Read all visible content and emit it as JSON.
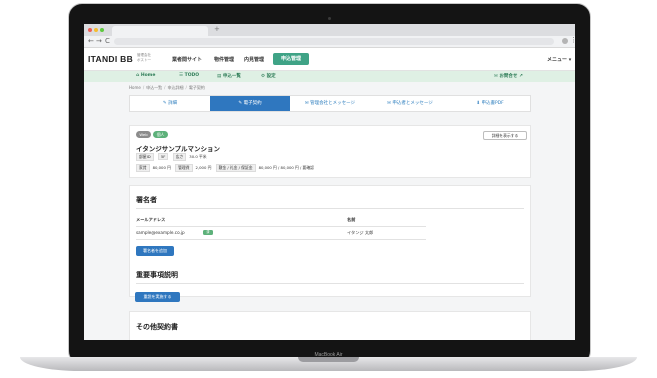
{
  "device": {
    "label": "MacBook Air"
  },
  "browser": {
    "new_tab_glyph": "+",
    "back_glyph": "←",
    "forward_glyph": "→",
    "reload_glyph": "C",
    "menu_glyph": "⋮",
    "traffic_lights": [
      "#ee5f57",
      "#f5bd2f",
      "#5ec93f"
    ]
  },
  "header": {
    "logo": "ITANDI BB",
    "logo_sub": "管理会社 ポスト一",
    "nav": [
      "業者間サイト",
      "物件管理",
      "内見管理"
    ],
    "nav_active": "申込管理",
    "menu": "メニュー ▾"
  },
  "subnav": {
    "items": [
      "Home",
      "TODO",
      "申込一覧",
      "設定"
    ],
    "contact": "お問合せ"
  },
  "breadcrumb": [
    "Home",
    "申込一覧",
    "申込詳細",
    "電子契約"
  ],
  "tabs": [
    "詳細",
    "電子契約",
    "管理会社とメッセージ",
    "申込者とメッセージ",
    "申込書PDF"
  ],
  "info": {
    "badges": [
      "Web",
      "個人"
    ],
    "detail_button": "詳細を表示する",
    "property_name": "イタンジサンプルマンション",
    "row1": [
      {
        "key": "部屋ID",
        "value": ""
      },
      {
        "key": "5F",
        "value": ""
      },
      {
        "key": "広さ",
        "value": "30.0 平米"
      }
    ],
    "row2": [
      {
        "key": "家賃",
        "value": "80,000 円"
      },
      {
        "key": "管理費",
        "value": "2,000 円"
      },
      {
        "key": "敷金 / 礼金 / 保証金",
        "value": "80,000 円 / 80,000 円 / 要確認"
      }
    ]
  },
  "signer": {
    "title": "署名者",
    "col_email": "メールアドレス",
    "col_name": "名前",
    "email": "sample@example.co.jp",
    "tag": "済",
    "name": "イタンジ 太郎",
    "add_button": "署名者を追加"
  },
  "important": {
    "title": "重要事項説明",
    "button": "重説を実施する"
  },
  "others": {
    "title": "その他契約書"
  },
  "colors": {
    "accent_green": "#3fa386",
    "primary_blue": "#2f77bf",
    "subnav_bg": "#dff0e4"
  }
}
